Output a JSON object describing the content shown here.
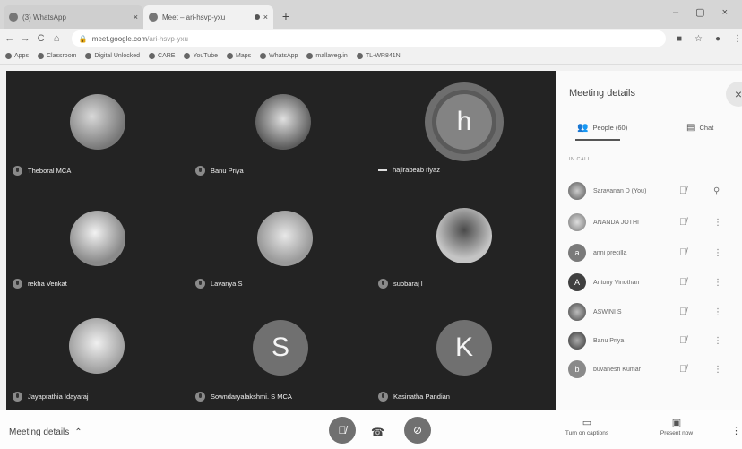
{
  "browser": {
    "tabs": [
      {
        "label": "(3) WhatsApp",
        "close": "×"
      },
      {
        "label": "Meet – ari-hsvp-yxu",
        "close": "×"
      }
    ],
    "new_tab": "+",
    "window_controls": "– ▢ ×",
    "url_domain": "meet.google.com",
    "url_path": "/ari-hsvp-yxu",
    "bookmarks": [
      "Apps",
      "Classroom",
      "Digital Unlocked",
      "CARE",
      "YouTube",
      "Maps",
      "WhatsApp",
      "mallaveg.in",
      "TL-WR841N"
    ]
  },
  "tiles": [
    {
      "name": "Theboral MCA"
    },
    {
      "name": "Banu Priya"
    },
    {
      "name": "hajirabeab riyaz",
      "initial": "h"
    },
    {
      "name": "rekha Venkat"
    },
    {
      "name": "Lavanya S"
    },
    {
      "name": "subbaraj l"
    },
    {
      "name": "Jayaprathia Idayaraj"
    },
    {
      "name": "Sowndaryalakshmi. S MCA",
      "initial": "S"
    },
    {
      "name": "Kasinatha Pandian",
      "initial": "K"
    }
  ],
  "panel": {
    "title": "Meeting details",
    "close": "×",
    "tab_people": "People (60)",
    "tab_chat": "Chat",
    "in_call_label": "IN CALL",
    "participants": [
      {
        "name": "Saravanan D (You)",
        "initial": ""
      },
      {
        "name": "ANANDA JOTHI",
        "initial": ""
      },
      {
        "name": "anni precilla",
        "initial": "a"
      },
      {
        "name": "Antony Vinothan",
        "initial": "A"
      },
      {
        "name": "ASWINI S",
        "initial": ""
      },
      {
        "name": "Banu Priya",
        "initial": ""
      },
      {
        "name": "buvanesh Kumar",
        "initial": "b"
      }
    ]
  },
  "bottom": {
    "meeting_details": "Meeting details",
    "captions": "Turn on captions",
    "present": "Present now"
  },
  "colors": {
    "stage": "#232323",
    "panel": "#fafafa",
    "control": "#707070"
  }
}
